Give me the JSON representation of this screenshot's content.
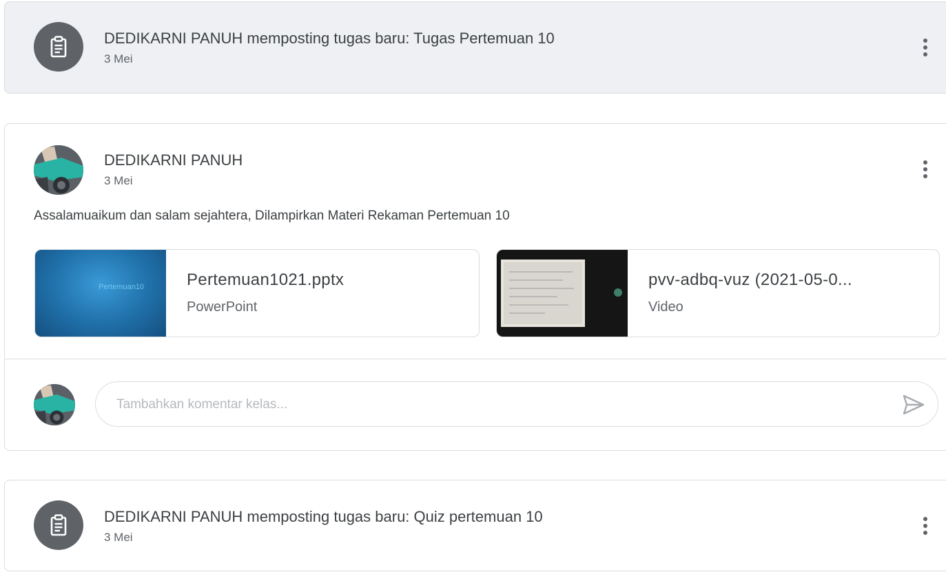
{
  "posts": [
    {
      "kind": "assignment",
      "title": "DEDIKARNI PANUH memposting tugas baru: Tugas Pertemuan 10",
      "date": "3 Mei",
      "icon": "assignment-icon"
    },
    {
      "kind": "announcement",
      "author": "DEDIKARNI PANUH",
      "date": "3 Mei",
      "text": "Assalamuaikum dan salam sejahtera, Dilampirkan Materi Rekaman Pertemuan 10",
      "attachments": [
        {
          "title": "Pertemuan1021.pptx",
          "type": "PowerPoint",
          "thumb_text": "Pertemuan10",
          "thumb_color": "#2a7fb8"
        },
        {
          "title": "pvv-adbq-vuz (2021-05-0...",
          "type": "Video",
          "thumb_color": "#1a1a1a"
        }
      ],
      "comment_placeholder": "Tambahkan komentar kelas..."
    },
    {
      "kind": "assignment",
      "title": "DEDIKARNI PANUH memposting tugas baru: Quiz pertemuan 10",
      "date": "3 Mei",
      "icon": "assignment-icon"
    }
  ],
  "colors": {
    "icon_bg": "#5f6368",
    "card_grey": "#eef0f3",
    "border": "#dadce0"
  }
}
